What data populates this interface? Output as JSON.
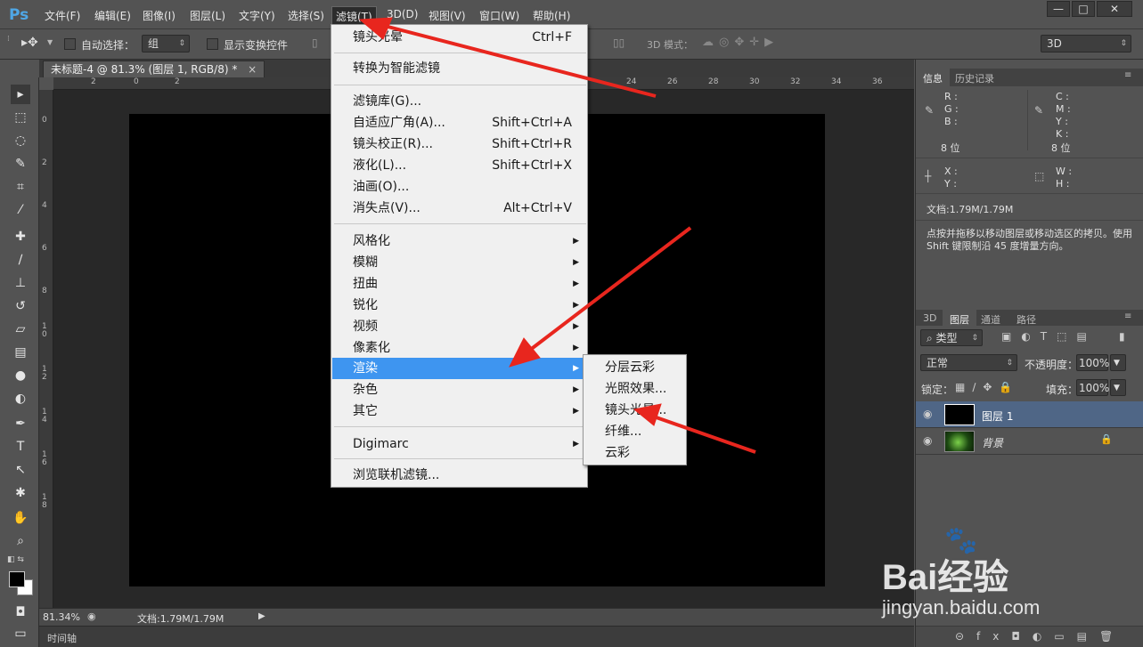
{
  "app": {
    "logo": "Ps"
  },
  "menubar": {
    "items": [
      "文件(F)",
      "编辑(E)",
      "图像(I)",
      "图层(L)",
      "文字(Y)",
      "选择(S)",
      "滤镜(T)",
      "3D(D)",
      "视图(V)",
      "窗口(W)",
      "帮助(H)"
    ],
    "active": "滤镜(T)",
    "window_controls": [
      "—",
      "□",
      "✕"
    ]
  },
  "options": {
    "auto_select_label": "自动选择：",
    "auto_select_value": "组",
    "show_transform_label": "显示变换控件",
    "mode_3d_label": "3D 模式：",
    "workspace_value": "3D"
  },
  "document": {
    "tab_title": "未标题-4 @ 81.3% (图层 1, RGB/8) *",
    "tab_close": "×",
    "zoom": "81.34%",
    "doc_size": "文档:1.79M/1.79M",
    "top_ruler": [
      "2",
      "0",
      "2",
      "24",
      "26",
      "28",
      "30",
      "32",
      "34",
      "36"
    ],
    "left_ruler": [
      "0",
      "2",
      "4",
      "6",
      "8",
      "10",
      "12",
      "14",
      "16",
      "18"
    ]
  },
  "filter_menu": {
    "items": [
      {
        "label": "镜头光晕",
        "shortcut": "Ctrl+F"
      },
      {
        "label": "转换为智能滤镜",
        "shortcut": ""
      },
      {
        "label": "滤镜库(G)...",
        "shortcut": ""
      },
      {
        "label": "自适应广角(A)...",
        "shortcut": "Shift+Ctrl+A"
      },
      {
        "label": "镜头校正(R)...",
        "shortcut": "Shift+Ctrl+R"
      },
      {
        "label": "液化(L)...",
        "shortcut": "Shift+Ctrl+X"
      },
      {
        "label": "油画(O)...",
        "shortcut": ""
      },
      {
        "label": "消失点(V)...",
        "shortcut": "Alt+Ctrl+V"
      },
      {
        "label": "风格化",
        "shortcut": ""
      },
      {
        "label": "模糊",
        "shortcut": ""
      },
      {
        "label": "扭曲",
        "shortcut": ""
      },
      {
        "label": "锐化",
        "shortcut": ""
      },
      {
        "label": "视频",
        "shortcut": ""
      },
      {
        "label": "像素化",
        "shortcut": ""
      },
      {
        "label": "渲染",
        "shortcut": ""
      },
      {
        "label": "杂色",
        "shortcut": ""
      },
      {
        "label": "其它",
        "shortcut": ""
      },
      {
        "label": "Digimarc",
        "shortcut": ""
      },
      {
        "label": "浏览联机滤镜...",
        "shortcut": ""
      }
    ],
    "highlighted": "渲染"
  },
  "render_submenu": {
    "items": [
      "分层云彩",
      "光照效果...",
      "镜头光晕...",
      "纤维...",
      "云彩"
    ]
  },
  "info_panel": {
    "tabs": [
      "信息",
      "历史记录"
    ],
    "rgb_labels": [
      "R :",
      "G :",
      "B :"
    ],
    "cmyk_labels": [
      "C :",
      "M :",
      "Y :",
      "K :"
    ],
    "bit_depth_left": "8 位",
    "bit_depth_right": "8 位",
    "xy_labels": [
      "X :",
      "Y :"
    ],
    "wh_labels": [
      "W :",
      "H :"
    ],
    "doc_info": "文档:1.79M/1.79M",
    "hint": "点按并拖移以移动图层或移动选区的拷贝。使用 Shift 键限制沿 45 度增量方向。"
  },
  "layers_panel": {
    "tabs": [
      "3D",
      "图层",
      "通道",
      "路径"
    ],
    "filter_kind": "类型",
    "blend_mode": "正常",
    "opacity_label": "不透明度：",
    "opacity_value": "100%",
    "lock_label": "锁定：",
    "fill_label": "填充：",
    "fill_value": "100%",
    "layers": [
      {
        "name": "图层 1",
        "selected": true
      },
      {
        "name": "背景",
        "selected": false
      }
    ]
  },
  "timeline": {
    "label": "时间轴"
  },
  "watermark": {
    "brand": "Bai经验",
    "url": "jingyan.baidu.com"
  },
  "colors": {
    "highlight": "#3e95f0",
    "arrow": "#e8261e",
    "ps_blue": "#4fa7e6"
  }
}
